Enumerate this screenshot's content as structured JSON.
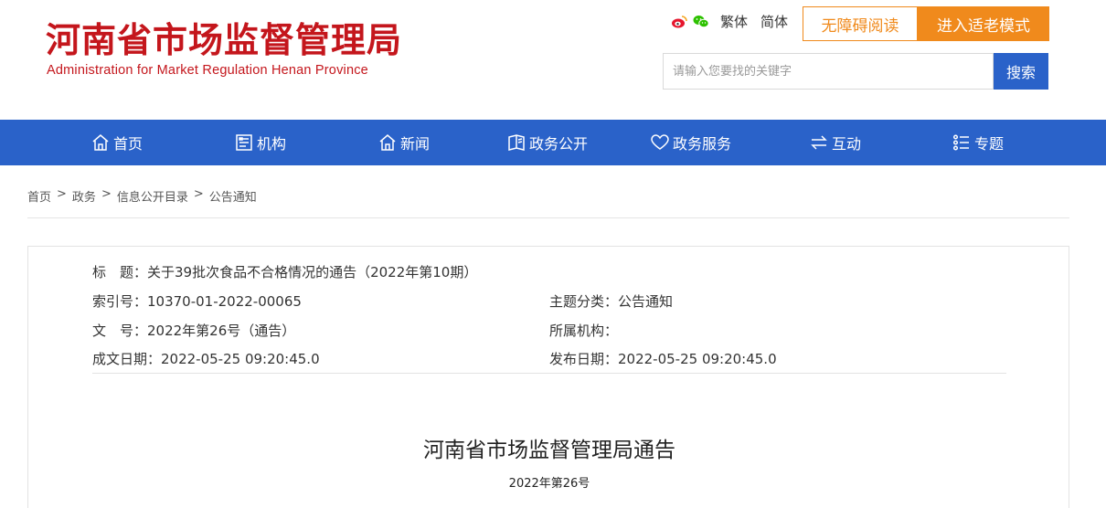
{
  "site": {
    "name_cn": "河南省市场监督管理局",
    "name_en": "Administration for Market Regulation Henan Province",
    "brand_color": "#c4161c"
  },
  "toplinks": {
    "weibo_icon": "weibo-icon",
    "wechat_icon": "wechat-icon",
    "traditional": "繁体",
    "simplified": "简体"
  },
  "buttons": {
    "accessible": "无障碍阅读",
    "elder_mode": "进入适老模式",
    "accent": "#f08a1c"
  },
  "search": {
    "placeholder": "请输入您要找的关键字",
    "button": "搜索"
  },
  "nav": {
    "color": "#2a62c9",
    "items": [
      {
        "label": "首页",
        "icon": "home-icon"
      },
      {
        "label": "机构",
        "icon": "org-icon"
      },
      {
        "label": "新闻",
        "icon": "news-icon"
      },
      {
        "label": "政务公开",
        "icon": "book-icon"
      },
      {
        "label": "政务服务",
        "icon": "heart-icon"
      },
      {
        "label": "互动",
        "icon": "exchange-icon"
      },
      {
        "label": "专题",
        "icon": "list-icon"
      }
    ]
  },
  "breadcrumb": [
    "首页",
    "政务",
    "信息公开目录",
    "公告通知"
  ],
  "meta": {
    "title": "标　题：关于39批次食品不合格情况的通告（2022年第10期）",
    "index_no": "索引号：10370-01-2022-00065",
    "category": "主题分类：公告通知",
    "doc_no": "文　号：2022年第26号（通告）",
    "org": "所属机构：",
    "created": "成文日期：2022-05-25 09:20:45.0",
    "published": "发布日期：2022-05-25 09:20:45.0"
  },
  "document": {
    "heading": "河南省市场监督管理局通告",
    "number": "2022年第26号"
  }
}
